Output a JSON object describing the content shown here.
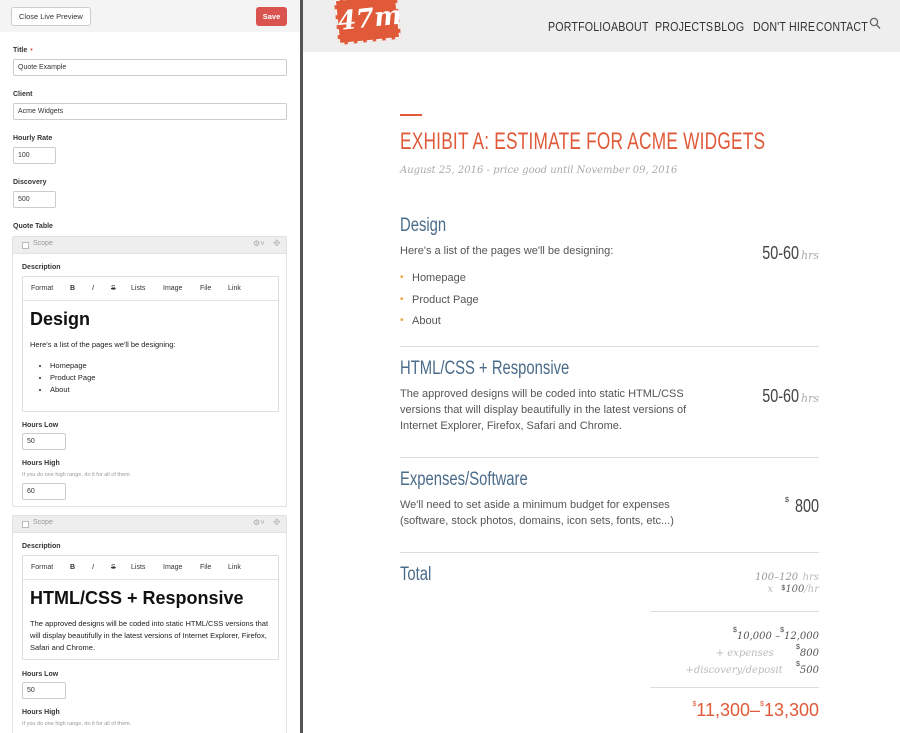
{
  "editor": {
    "close_label": "Close Live Preview",
    "save_label": "Save",
    "title_label": "Title",
    "required_mark": "•",
    "title_value": "Quote Example",
    "client_label": "Client",
    "client_value": "Acme Widgets",
    "rate_label": "Hourly Rate",
    "rate_value": "100",
    "discovery_label": "Discovery",
    "discovery_value": "500",
    "table_label": "Quote Table",
    "toolbar": [
      "Format",
      "B",
      "I",
      "S",
      "Lists",
      "Image",
      "File",
      "Link"
    ],
    "blocks": [
      {
        "scope": "Scope",
        "description_label": "Description",
        "heading": "Design",
        "text": "Here's a list of the pages we'll be designing:",
        "items": [
          "Homepage",
          "Product Page",
          "About"
        ],
        "hours_low_label": "Hours Low",
        "hours_low": "50",
        "hours_high_label": "Hours High",
        "hours_high_help": "If you do one high range, do it for all of them.",
        "hours_high": "60"
      },
      {
        "scope": "Scope",
        "description_label": "Description",
        "heading": "HTML/CSS + Responsive",
        "text": "The approved designs will be coded into static HTML/CSS versions that will display beautifully in the latest versions of Internet Explorer, Firefox, Safari and Chrome.",
        "hours_low_label": "Hours Low",
        "hours_low": "50",
        "hours_high_label": "Hours High",
        "hours_high_help": "If you do one high range, do it for all of them."
      }
    ]
  },
  "preview": {
    "logo": "47m",
    "nav": [
      "PORTFOLIO",
      "ABOUT",
      "PROJECTS",
      "BLOG",
      "DON'T HIRE",
      "CONTACT"
    ],
    "title": "EXHIBIT A: ESTIMATE FOR ACME WIDGETS",
    "date": "August 25, 2016 - price good until November 09, 2016",
    "sections": [
      {
        "heading": "Design",
        "text": "Here's a list of the pages we'll be designing:",
        "items": [
          "Homepage",
          "Product Page",
          "About"
        ],
        "hours": "50-60",
        "unit": "hrs"
      },
      {
        "heading": "HTML/CSS + Responsive",
        "text": "The approved designs will be coded into static HTML/CSS versions that will display beautifully in the latest versions of Internet Explorer, Firefox, Safari and Chrome.",
        "hours": "50-60",
        "unit": "hrs"
      },
      {
        "heading": "Expenses/Software",
        "text": "We'll need to set aside a minimum budget for expenses (software, stock photos, domains, icon sets, fonts, etc...)",
        "currency": "$",
        "amount": "800"
      }
    ],
    "total": {
      "heading": "Total",
      "hours_range": "100–120",
      "hrs": "hrs",
      "times": "x",
      "currency": "$",
      "rate": "100",
      "per_hr": "/hr",
      "subtotal_low": "10,000",
      "subtotal_sep": " –",
      "subtotal_high": "12,000",
      "expenses_label": "+ expenses",
      "expenses": "800",
      "discovery_label": "+discovery/deposit",
      "discovery": "500",
      "grand_low": "11,300",
      "grand_sep": "–",
      "grand_high": "13,300"
    }
  }
}
